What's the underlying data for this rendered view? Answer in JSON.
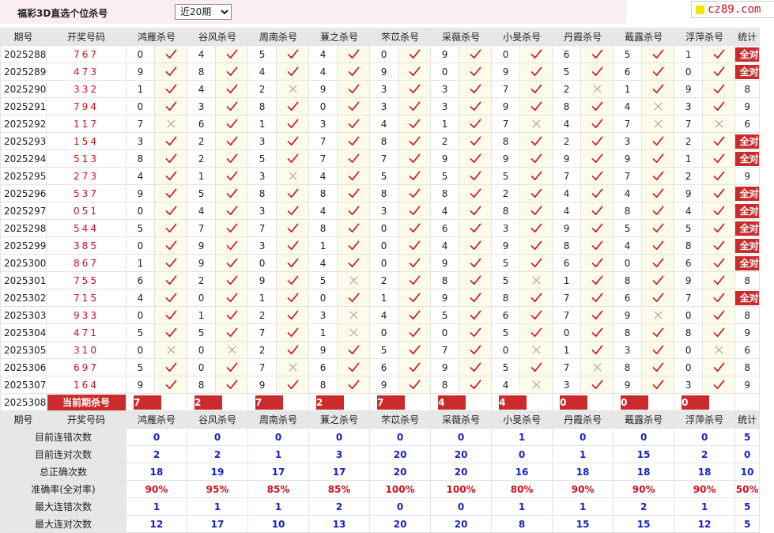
{
  "header": {
    "title": "福彩3D直选个位杀号",
    "period_select": {
      "value": "近20期",
      "options": [
        "近20期"
      ]
    },
    "site_logo": "cz89.com"
  },
  "colors": {
    "accent": "#cb2b2b",
    "number_red": "#d0101c",
    "stat_blue": "#1722c8",
    "header_bg": "#e7e7e7",
    "mark_cell_bg": "#fdfbea"
  },
  "table": {
    "columns": {
      "issue": "期号",
      "draw_number": "开奖号码",
      "stats": "统计"
    },
    "experts": [
      "鸿雁杀号",
      "谷风杀号",
      "周南杀号",
      "蒹之杀号",
      "芣苡杀号",
      "采薇杀号",
      "小旻杀号",
      "丹霞杀号",
      "蕺露杀号",
      "浮萍杀号"
    ],
    "rows": [
      {
        "issue": "2025288",
        "number": "767",
        "kills": [
          "0",
          "4",
          "5",
          "4",
          "0",
          "9",
          "0",
          "6",
          "5",
          "1"
        ],
        "hits": [
          1,
          1,
          1,
          1,
          1,
          1,
          1,
          1,
          1,
          1
        ],
        "stat": "全对"
      },
      {
        "issue": "2025289",
        "number": "473",
        "kills": [
          "9",
          "8",
          "4",
          "4",
          "9",
          "0",
          "9",
          "5",
          "6",
          "0"
        ],
        "hits": [
          1,
          1,
          1,
          1,
          1,
          1,
          1,
          1,
          1,
          1
        ],
        "stat": "全对"
      },
      {
        "issue": "2025290",
        "number": "332",
        "kills": [
          "1",
          "4",
          "2",
          "9",
          "3",
          "3",
          "7",
          "2",
          "1",
          "9"
        ],
        "hits": [
          1,
          1,
          0,
          1,
          1,
          1,
          1,
          0,
          1,
          1
        ],
        "stat": "8"
      },
      {
        "issue": "2025291",
        "number": "794",
        "kills": [
          "0",
          "3",
          "8",
          "0",
          "3",
          "3",
          "9",
          "8",
          "4",
          "3"
        ],
        "hits": [
          1,
          1,
          1,
          1,
          1,
          1,
          1,
          1,
          0,
          1
        ],
        "stat": "9"
      },
      {
        "issue": "2025292",
        "number": "117",
        "kills": [
          "7",
          "6",
          "1",
          "3",
          "4",
          "1",
          "7",
          "4",
          "7",
          "7"
        ],
        "hits": [
          0,
          1,
          1,
          1,
          1,
          1,
          0,
          1,
          0,
          0
        ],
        "stat": "6"
      },
      {
        "issue": "2025293",
        "number": "154",
        "kills": [
          "3",
          "2",
          "3",
          "7",
          "8",
          "2",
          "8",
          "2",
          "3",
          "2"
        ],
        "hits": [
          1,
          1,
          1,
          1,
          1,
          1,
          1,
          1,
          1,
          1
        ],
        "stat": "全对"
      },
      {
        "issue": "2025294",
        "number": "513",
        "kills": [
          "8",
          "2",
          "5",
          "7",
          "7",
          "9",
          "9",
          "9",
          "9",
          "1"
        ],
        "hits": [
          1,
          1,
          1,
          1,
          1,
          1,
          1,
          1,
          1,
          1
        ],
        "stat": "全对"
      },
      {
        "issue": "2025295",
        "number": "273",
        "kills": [
          "4",
          "1",
          "3",
          "4",
          "5",
          "5",
          "5",
          "7",
          "7",
          "2"
        ],
        "hits": [
          1,
          1,
          0,
          1,
          1,
          1,
          1,
          1,
          1,
          1
        ],
        "stat": "9"
      },
      {
        "issue": "2025296",
        "number": "537",
        "kills": [
          "9",
          "5",
          "8",
          "8",
          "8",
          "8",
          "2",
          "4",
          "4",
          "9"
        ],
        "hits": [
          1,
          1,
          1,
          1,
          1,
          1,
          1,
          1,
          1,
          1
        ],
        "stat": "全对"
      },
      {
        "issue": "2025297",
        "number": "051",
        "kills": [
          "0",
          "4",
          "3",
          "4",
          "3",
          "4",
          "8",
          "4",
          "8",
          "4"
        ],
        "hits": [
          1,
          1,
          1,
          1,
          1,
          1,
          1,
          1,
          1,
          1
        ],
        "stat": "全对"
      },
      {
        "issue": "2025298",
        "number": "544",
        "kills": [
          "5",
          "7",
          "7",
          "8",
          "0",
          "6",
          "3",
          "9",
          "5",
          "5"
        ],
        "hits": [
          1,
          1,
          1,
          1,
          1,
          1,
          1,
          1,
          1,
          1
        ],
        "stat": "全对"
      },
      {
        "issue": "2025299",
        "number": "385",
        "kills": [
          "0",
          "9",
          "3",
          "1",
          "0",
          "4",
          "9",
          "8",
          "4",
          "8"
        ],
        "hits": [
          1,
          1,
          1,
          1,
          1,
          1,
          1,
          1,
          1,
          1
        ],
        "stat": "全对"
      },
      {
        "issue": "2025300",
        "number": "867",
        "kills": [
          "1",
          "9",
          "0",
          "4",
          "0",
          "9",
          "5",
          "6",
          "0",
          "6"
        ],
        "hits": [
          1,
          1,
          1,
          1,
          1,
          1,
          1,
          1,
          1,
          1
        ],
        "stat": "全对"
      },
      {
        "issue": "2025301",
        "number": "755",
        "kills": [
          "6",
          "2",
          "9",
          "5",
          "2",
          "8",
          "5",
          "1",
          "8",
          "9"
        ],
        "hits": [
          1,
          1,
          1,
          0,
          1,
          1,
          0,
          1,
          1,
          1
        ],
        "stat": "8"
      },
      {
        "issue": "2025302",
        "number": "715",
        "kills": [
          "4",
          "0",
          "1",
          "0",
          "1",
          "9",
          "8",
          "7",
          "6",
          "7"
        ],
        "hits": [
          1,
          1,
          1,
          1,
          1,
          1,
          1,
          1,
          1,
          1
        ],
        "stat": "全对"
      },
      {
        "issue": "2025303",
        "number": "933",
        "kills": [
          "0",
          "1",
          "2",
          "3",
          "4",
          "5",
          "6",
          "7",
          "9",
          "0"
        ],
        "hits": [
          1,
          1,
          1,
          0,
          1,
          1,
          1,
          1,
          0,
          1
        ],
        "stat": "8"
      },
      {
        "issue": "2025304",
        "number": "471",
        "kills": [
          "5",
          "5",
          "7",
          "1",
          "0",
          "0",
          "5",
          "0",
          "8",
          "8"
        ],
        "hits": [
          1,
          1,
          1,
          0,
          1,
          1,
          1,
          1,
          1,
          1
        ],
        "stat": "9"
      },
      {
        "issue": "2025305",
        "number": "310",
        "kills": [
          "0",
          "0",
          "2",
          "9",
          "5",
          "7",
          "0",
          "1",
          "3",
          "0"
        ],
        "hits": [
          0,
          0,
          1,
          1,
          1,
          1,
          0,
          1,
          1,
          0
        ],
        "stat": "6"
      },
      {
        "issue": "2025306",
        "number": "697",
        "kills": [
          "5",
          "0",
          "7",
          "6",
          "6",
          "9",
          "5",
          "7",
          "8",
          "0"
        ],
        "hits": [
          1,
          1,
          0,
          1,
          1,
          1,
          1,
          0,
          1,
          1
        ],
        "stat": "8"
      },
      {
        "issue": "2025307",
        "number": "164",
        "kills": [
          "9",
          "8",
          "9",
          "8",
          "9",
          "8",
          "4",
          "3",
          "9",
          "3"
        ],
        "hits": [
          1,
          1,
          1,
          1,
          1,
          1,
          0,
          1,
          1,
          1
        ],
        "stat": "9"
      }
    ],
    "current": {
      "issue": "2025308",
      "label": "当前期杀号",
      "kills": [
        "7",
        "2",
        "7",
        "2",
        "7",
        "4",
        "4",
        "0",
        "0",
        "0"
      ]
    },
    "stats": [
      {
        "label": "目前连错次数",
        "values": [
          "0",
          "0",
          "0",
          "0",
          "0",
          "0",
          "1",
          "0",
          "0",
          "0",
          "5"
        ]
      },
      {
        "label": "目前连对次数",
        "values": [
          "2",
          "2",
          "1",
          "3",
          "20",
          "20",
          "0",
          "1",
          "15",
          "2",
          "0"
        ]
      },
      {
        "label": "总正确次数",
        "values": [
          "18",
          "19",
          "17",
          "17",
          "20",
          "20",
          "16",
          "18",
          "18",
          "18",
          "10"
        ]
      },
      {
        "label": "准确率(全对率)",
        "values": [
          "90%",
          "95%",
          "85%",
          "85%",
          "100%",
          "100%",
          "80%",
          "90%",
          "90%",
          "90%",
          "50%"
        ]
      },
      {
        "label": "最大连错次数",
        "values": [
          "1",
          "1",
          "1",
          "2",
          "0",
          "0",
          "1",
          "1",
          "2",
          "1",
          "5"
        ]
      },
      {
        "label": "最大连对次数",
        "values": [
          "12",
          "17",
          "10",
          "13",
          "20",
          "20",
          "8",
          "15",
          "15",
          "12",
          "5"
        ]
      }
    ]
  }
}
